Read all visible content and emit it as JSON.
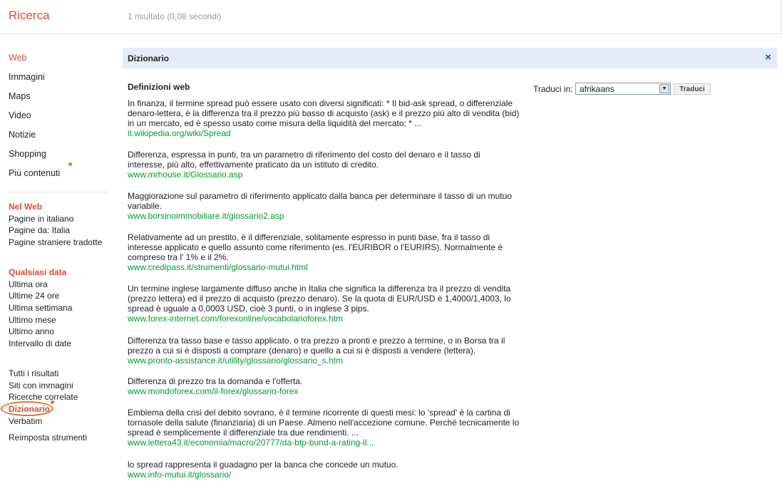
{
  "header": {
    "brand": "Ricerca",
    "stats": "1 risultato (0,08 secondi)"
  },
  "sidebar": {
    "modes": [
      "Web",
      "Immagini",
      "Maps",
      "Video",
      "Notizie",
      "Shopping",
      "Più contenuti"
    ],
    "web_section": {
      "title": "Nel Web",
      "options": [
        "Pagine in italiano",
        "Pagine da: Italia",
        "Pagine straniere tradotte"
      ]
    },
    "date_section": {
      "title": "Qualsiasi data",
      "options": [
        "Ultima ora",
        "Ultime 24 ore",
        "Ultima settimana",
        "Ultimo mese",
        "Ultimo anno",
        "Intervallo di date"
      ]
    },
    "results_section": {
      "options": [
        "Tutti i risultati",
        "Siti con immagini",
        "Ricerche correlate",
        "Dizionario",
        "Verbatim"
      ]
    },
    "reset": "Reimposta strumenti"
  },
  "dictionary": {
    "title": "Dizionario",
    "close": "×",
    "defs_title": "Definizioni web",
    "definitions": [
      {
        "text": "In finanza, il termine spread può essere usato con diversi significati: * Il bid-ask spread, o differenziale denaro-lettera, è la differenza tra il prezzo più basso di acquisto (ask) e il prezzo più alto di vendita (bid) in un mercato, ed è spesso usato come misura della liquidità del mercato; * ...",
        "source": "it.wikipedia.org/wiki/Spread"
      },
      {
        "text": "Differenza, espressa in punti, tra un parametro di riferimento del costo del denaro e il tasso di interesse, più alto, effettivamente praticato da un istituto di credito.",
        "source": "www.mrhouse.it/Glossario.asp"
      },
      {
        "text": "Maggiorazione sul parametro di riferimento applicato dalla banca per determinare il tasso di un mutuo variabile.",
        "source": "www.borsinoimmobiliare.it/glossario2.asp"
      },
      {
        "text": "Relativamente ad un prestito, è il differenziale, solitamente espresso in punti base, fra il tasso di interesse applicato e quello assunto come riferimento (es. l'EURIBOR o l'EURIRS). Normalmente è compreso tra l' 1% e il 2%.",
        "source": "www.credipass.it/strumenti/glossario-mutui.html"
      },
      {
        "text": "Un termine inglese largamente diffuso anche in Italia che significa la differenza tra il prezzo di vendita (prezzo lettera) ed il prezzo di acquisto (prezzo denaro). Se la quota di EUR/USD è 1,4000/1,4003, lo spread è uguale a 0,0003 USD, cioè 3 punti, o in inglese 3 pips.",
        "source": "www.forex-internet.com/forexonline/vocabolarioforex.htm"
      },
      {
        "text": "Differenza tra tasso base e tasso applicato, o tra prezzo a pronti e prezzo a termine, o in Borsa tra il prezzo a cui si è disposti a comprare (denaro) e quello a cui si è disposti a vendere (lettera).",
        "source": "www.pronto-assistance.it/utility/glossario/glossario_s.htm"
      },
      {
        "text": "Differenza di prezzo tra la domanda e l'offerta.",
        "source": "www.mondoforex.com/il-forex/glossario-forex"
      },
      {
        "text": "Emblema della crisi del debito sovrano, è il termine ricorrente di questi mesi: lo 'spread' è la cartina di tornasole della salute (finanziaria) di un Paese. Almeno nell'accezione comune. Perché tecnicamente lo spread è semplicemente il differenziale tra due rendimenti. ...",
        "source": "www.lettera43.it/economia/macro/20777/da-btp-bund-a-rating-il..."
      },
      {
        "text": "lo spread rappresenta il guadagno per la banca che concede un mutuo.",
        "source": "www.info-mutui.it/glossario/"
      }
    ],
    "translate": {
      "label": "Traduci in:",
      "selected": "afrikaans",
      "button": "Traduci"
    }
  },
  "colors": {
    "accent": "#dd4b39",
    "link_green": "#009933",
    "header_blue": "#e5ecf9",
    "marker_orange": "#e8731b"
  }
}
